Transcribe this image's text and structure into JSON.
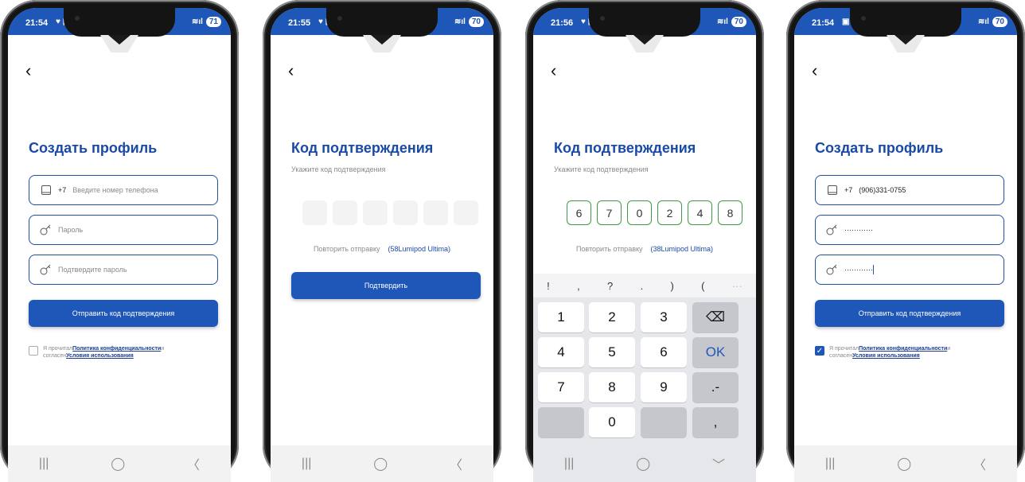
{
  "phones": [
    {
      "status": {
        "time": "21:54",
        "icons": "♥ ▣",
        "battery": "71"
      },
      "title": "Создать профиль",
      "phone_field": {
        "prefix": "+7",
        "placeholder": "Введите номер телефона"
      },
      "password_field": {
        "placeholder": "Пароль"
      },
      "confirm_field": {
        "placeholder": "Подтвердите пароль"
      },
      "submit_label": "Отправить код подтверждения",
      "agree": {
        "prefix1": "Я прочитал",
        "policy": "Политика конфиденциальности",
        "suffix1": "и",
        "prefix2": "согласен",
        "terms": "Условия использования",
        "checked": false
      }
    },
    {
      "status": {
        "time": "21:55",
        "icons": "♥ ▣",
        "battery": "70"
      },
      "title": "Код подтверждения",
      "subtitle": "Укажите код подтверждения",
      "resend_label": "Повторить отправку",
      "resend_timer": "(58Lumipod Ultima)",
      "confirm_label": "Подтвердить"
    },
    {
      "status": {
        "time": "21:56",
        "icons": "♥ ▣",
        "battery": "70"
      },
      "title": "Код подтверждения",
      "subtitle": "Укажите код подтверждения",
      "code": [
        "6",
        "7",
        "0",
        "2",
        "4",
        "8"
      ],
      "resend_label": "Повторить отправку",
      "resend_timer": "(38Lumipod Ultima)",
      "symbols": [
        "!",
        ",",
        "?",
        ".",
        ")",
        "(",
        "···"
      ],
      "keys": {
        "k1": "1",
        "k2": "2",
        "k3": "3",
        "k4": "4",
        "k5": "5",
        "k6": "6",
        "k7": "7",
        "k8": "8",
        "k9": "9",
        "k0": "0",
        "ok": "OK",
        "minus": ".-",
        "comma": ",",
        "backspace": "⌫"
      }
    },
    {
      "status": {
        "time": "21:54",
        "icons": "▣ ♥",
        "battery": "70"
      },
      "title": "Создать профиль",
      "phone_field": {
        "prefix": "+7",
        "value": "(906)331-0755"
      },
      "password_field": {
        "value": "············"
      },
      "confirm_field": {
        "value": "············"
      },
      "submit_label": "Отправить код подтверждения",
      "agree": {
        "prefix1": "Я прочитал",
        "policy": "Политика конфиденциальности",
        "suffix1": "и",
        "prefix2": "согласен",
        "terms": "Условия использования",
        "checked": true
      }
    }
  ],
  "nav": {
    "recent": "|||",
    "home": "◯",
    "back": "〈",
    "hide": "﹀"
  },
  "icons": {
    "back": "‹",
    "phone": "phone-icon",
    "key": "key-icon"
  },
  "colors": {
    "primary": "#1f57b8",
    "title": "#1a4aa6",
    "code_border": "#3e9b43"
  }
}
